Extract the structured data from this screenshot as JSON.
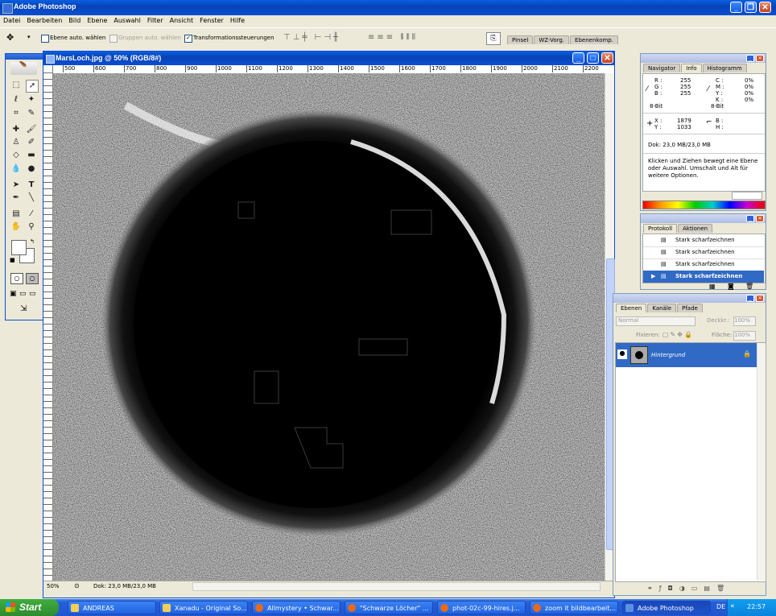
{
  "app": {
    "title": "Adobe Photoshop"
  },
  "menu": [
    "Datei",
    "Bearbeiten",
    "Bild",
    "Ebene",
    "Auswahl",
    "Filter",
    "Ansicht",
    "Fenster",
    "Hilfe"
  ],
  "options_bar": {
    "auto_select_layer": "Ebene auto. wählen",
    "auto_select_groups": "Gruppen auto. wählen",
    "transform_controls": "Transformationssteuerungen",
    "palette_well_tabs": [
      "Pinsel",
      "WZ-Vorg.",
      "Ebenenkomp."
    ]
  },
  "document": {
    "title": "MarsLoch.jpg @ 50% (RGB/8#)",
    "ruler_marks": [
      "500",
      "600",
      "700",
      "800",
      "900",
      "1000",
      "1100",
      "1200",
      "1300",
      "1400",
      "1500",
      "1600",
      "1700",
      "1800",
      "1900",
      "2000",
      "2100",
      "2200"
    ],
    "zoom": "50%",
    "doc_size": "Dok: 23,0 MB/23,0 MB"
  },
  "info_panel": {
    "tabs": [
      "Navigator",
      "Info",
      "Histogramm"
    ],
    "active_tab": "Info",
    "rgb": {
      "r_label": "R :",
      "r": "255",
      "g_label": "G :",
      "g": "255",
      "b_label": "B :",
      "b": "255",
      "bits": "8-Bit"
    },
    "cmyk": {
      "c_label": "C :",
      "c": "0%",
      "m_label": "M :",
      "m": "0%",
      "y_label": "Y :",
      "y": "0%",
      "k_label": "K :",
      "k": "0%",
      "bits": "8-Bit"
    },
    "xy": {
      "x_label": "X :",
      "x": "1879",
      "y_label": "Y :",
      "y": "1033"
    },
    "bh": {
      "b_label": "B :",
      "h_label": "H :"
    },
    "doc": "Dok: 23,0 MB/23,0 MB",
    "hint": "Klicken und Ziehen bewegt eine Ebene oder Auswahl. Umschalt und Alt für weitere Optionen."
  },
  "history_panel": {
    "tabs": [
      "Protokoll",
      "Aktionen"
    ],
    "items": [
      "Stark scharfzeichnen",
      "Stark scharfzeichnen",
      "Stark scharfzeichnen",
      "Stark scharfzeichnen"
    ]
  },
  "layers_panel": {
    "tabs": [
      "Ebenen",
      "Kanäle",
      "Pfade"
    ],
    "blend_mode": "Normal",
    "opacity_label": "Deckkr.:",
    "opacity": "100%",
    "lock_label": "Fixieren:",
    "fill_label": "Fläche:",
    "fill": "100%",
    "layer_name": "Hintergrund"
  },
  "taskbar": {
    "start": "Start",
    "items": [
      "ANDREAS",
      "Xanadu - Original So...",
      "Allmystery • Schwar...",
      "\"Schwarze Löcher\" ...",
      "phot-02c-99-hires.j...",
      "zoom it bildbearbeit...",
      "Adobe Photoshop"
    ],
    "lang": "DE",
    "clock": "22:57"
  },
  "colors": {
    "xp_blue": "#0a4fd4",
    "panel_bg": "#ece9d8",
    "selection": "#316ac5",
    "taskbar_green": "#3c9b3c"
  }
}
